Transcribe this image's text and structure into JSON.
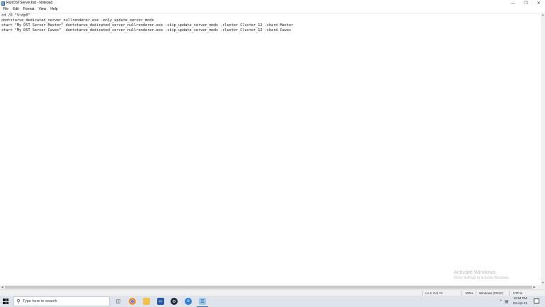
{
  "window": {
    "title": "RunDSTServer.bat - Notepad",
    "controls": {
      "minimize": "—",
      "maximize": "❐",
      "close": "✕"
    }
  },
  "menu": [
    "File",
    "Edit",
    "Format",
    "View",
    "Help"
  ],
  "editor": {
    "lines": [
      "cd /D \"%~dp0\"",
      "dontstarve_dedicated_server_nullrenderer.exe -only_update_server_mods",
      "start \"My DST Server Master\" dontstarve_dedicated_server_nullrenderer.exe -skip_update_server_mods -cluster Cluster_12 -shard Master",
      "start \"My DST Server Caves\"  dontstarve_dedicated_server_nullrenderer.exe -skip_update_server_mods -cluster Cluster_12 -shard Caves"
    ]
  },
  "status": {
    "position": "Ln 4, Col 74",
    "zoom": "100%",
    "line_ending": "Windows (CRLF)",
    "encoding": "UTF-8"
  },
  "watermark": {
    "title": "Activate Windows",
    "subtitle": "Go to Settings to activate Windows."
  },
  "taskbar": {
    "search_placeholder": "Type here to search",
    "icons": [
      "task-view-icon",
      "chrome-icon",
      "file-explorer-icon",
      "snipping-tool-icon",
      "steam-icon",
      "edge-icon",
      "notepad-icon"
    ],
    "clock_time": "11:54 PM",
    "clock_date": "04-Apr-21"
  }
}
